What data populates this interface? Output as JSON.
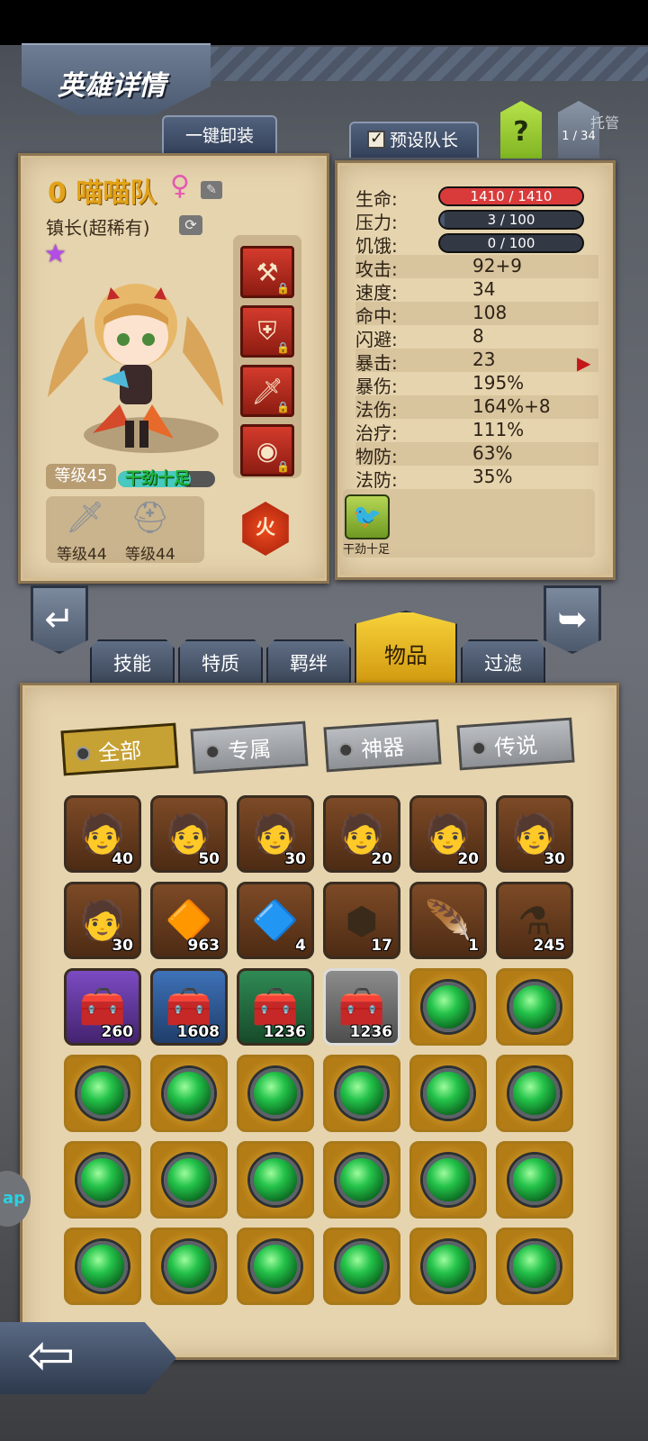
{
  "header": {
    "title": "英雄详情"
  },
  "top_buttons": {
    "unequip_all": "一键卸装",
    "preset_leader": "预设队长",
    "help": "?",
    "page_counter": "1 / 34",
    "auto_label": "托管"
  },
  "hero": {
    "name": "0 喵喵队",
    "gender_icon": "female-symbol-icon",
    "title": "镇长(超稀有)",
    "rarity_stars": 1,
    "level_label": "等级45",
    "mood_label": "干劲十足",
    "mood_fraction": 0.75,
    "element": "火",
    "equipment_slots": [
      "axe-icon",
      "shield-icon",
      "dagger-icon",
      "amulet-icon"
    ],
    "gear": [
      {
        "icon": "sword-icon",
        "label": "等级44"
      },
      {
        "icon": "helmet-icon",
        "label": "等级44"
      }
    ]
  },
  "stats": {
    "bars": [
      {
        "label": "生命:",
        "value": "1410 / 1410",
        "fraction": 1.0,
        "color": "#d93b3b"
      },
      {
        "label": "压力:",
        "value": "3 / 100",
        "fraction": 0.03,
        "color": "#4a5670"
      },
      {
        "label": "饥饿:",
        "value": "0 / 100",
        "fraction": 0.0,
        "color": "#4a5670"
      }
    ],
    "rows": [
      {
        "label": "攻击:",
        "value": "92+9"
      },
      {
        "label": "速度:",
        "value": "34"
      },
      {
        "label": "命中:",
        "value": "108"
      },
      {
        "label": "闪避:",
        "value": "8"
      },
      {
        "label": "暴击:",
        "value": "23"
      },
      {
        "label": "暴伤:",
        "value": "195%"
      },
      {
        "label": "法伤:",
        "value": "164%+8"
      },
      {
        "label": "治疗:",
        "value": "111%"
      },
      {
        "label": "物防:",
        "value": "63%"
      },
      {
        "label": "法防:",
        "value": "35%"
      }
    ],
    "trait": {
      "name": "干劲十足",
      "icon": "bird-trait-icon"
    }
  },
  "main_tabs": [
    "技能",
    "特质",
    "羁绊",
    "物品",
    "过滤"
  ],
  "active_main_tab": "物品",
  "filter_tabs": [
    "全部",
    "专属",
    "神器",
    "传说"
  ],
  "active_filter_tab": "全部",
  "items": [
    {
      "icon": "hero-portrait-icon",
      "count": "40",
      "frame": "brown"
    },
    {
      "icon": "hero-portrait-icon",
      "count": "50",
      "frame": "brown"
    },
    {
      "icon": "hero-portrait-icon",
      "count": "30",
      "frame": "brown"
    },
    {
      "icon": "hero-portrait-icon",
      "count": "20",
      "frame": "brown"
    },
    {
      "icon": "hero-portrait-icon",
      "count": "20",
      "frame": "brown"
    },
    {
      "icon": "hero-portrait-icon",
      "count": "30",
      "frame": "brown"
    },
    {
      "icon": "hero-portrait-icon",
      "count": "30",
      "frame": "brown"
    },
    {
      "icon": "orange-gem-icon",
      "count": "963",
      "frame": "brown"
    },
    {
      "icon": "crystal-pile-icon",
      "count": "4",
      "frame": "brown"
    },
    {
      "icon": "rune-stone-icon",
      "count": "17",
      "frame": "brown"
    },
    {
      "icon": "feather-icon",
      "count": "1",
      "frame": "brown"
    },
    {
      "icon": "potion-icon",
      "count": "245",
      "frame": "brown"
    },
    {
      "icon": "chest-icon",
      "count": "260",
      "frame": "purple"
    },
    {
      "icon": "chest-icon",
      "count": "1608",
      "frame": "blue"
    },
    {
      "icon": "chest-icon",
      "count": "1236",
      "frame": "green"
    },
    {
      "icon": "chest-icon",
      "count": "1236",
      "frame": "gray"
    },
    {
      "icon": "green-gem-icon",
      "count": "",
      "frame": "gold"
    },
    {
      "icon": "green-gem-icon",
      "count": "",
      "frame": "gold"
    },
    {
      "icon": "green-gem-icon",
      "count": "",
      "frame": "gold"
    },
    {
      "icon": "green-gem-icon",
      "count": "",
      "frame": "gold"
    },
    {
      "icon": "green-gem-icon",
      "count": "",
      "frame": "gold"
    },
    {
      "icon": "green-gem-icon",
      "count": "",
      "frame": "gold"
    },
    {
      "icon": "green-gem-icon",
      "count": "",
      "frame": "gold"
    },
    {
      "icon": "green-gem-icon",
      "count": "",
      "frame": "gold"
    },
    {
      "icon": "green-gem-icon",
      "count": "",
      "frame": "gold"
    },
    {
      "icon": "green-gem-icon",
      "count": "",
      "frame": "gold"
    },
    {
      "icon": "green-gem-icon",
      "count": "",
      "frame": "gold"
    },
    {
      "icon": "green-gem-icon",
      "count": "",
      "frame": "gold"
    },
    {
      "icon": "green-gem-icon",
      "count": "",
      "frame": "gold"
    },
    {
      "icon": "green-gem-icon",
      "count": "",
      "frame": "gold"
    },
    {
      "icon": "green-gem-icon",
      "count": "",
      "frame": "gold"
    },
    {
      "icon": "green-gem-icon",
      "count": "",
      "frame": "gold"
    },
    {
      "icon": "green-gem-icon",
      "count": "",
      "frame": "gold"
    },
    {
      "icon": "green-gem-icon",
      "count": "",
      "frame": "gold"
    },
    {
      "icon": "green-gem-icon",
      "count": "",
      "frame": "gold"
    },
    {
      "icon": "green-gem-icon",
      "count": "",
      "frame": "gold"
    }
  ],
  "side_bubble_text": "ap"
}
